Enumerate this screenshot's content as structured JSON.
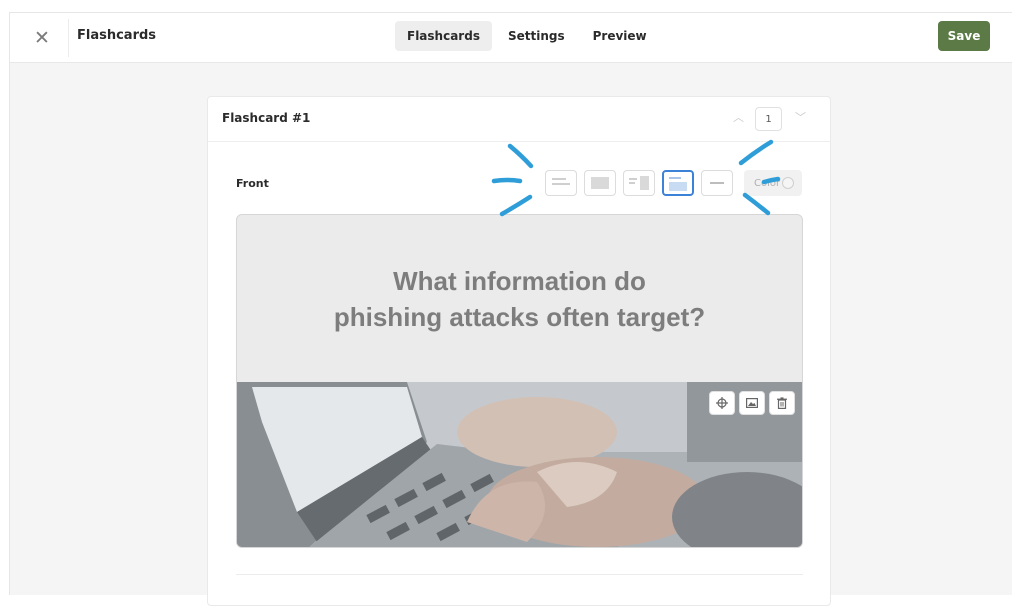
{
  "topbar": {
    "app_title": "Flashcards",
    "tabs": [
      {
        "label": "Flashcards",
        "active": true
      },
      {
        "label": "Settings",
        "active": false
      },
      {
        "label": "Preview",
        "active": false
      }
    ],
    "save_label": "Save",
    "close_icon": "close-icon",
    "accent_color": "#5b7a45"
  },
  "card": {
    "title": "Flashcard #1",
    "page_number": "1",
    "front_label": "Front",
    "layout_options": [
      "text-left-layout",
      "full-image-layout",
      "text-image-split-layout",
      "text-top-layout",
      "centered-text-layout"
    ],
    "selected_layout_index": 3,
    "color_label": "Color",
    "question_line1": "What information do",
    "question_line2": "phishing attacks often target?",
    "image_tools": [
      "focus-point-icon",
      "replace-image-icon",
      "delete-icon"
    ],
    "highlight_color": "#3c82d6"
  },
  "annotation": {
    "marker_color": "#2f9ed8"
  }
}
